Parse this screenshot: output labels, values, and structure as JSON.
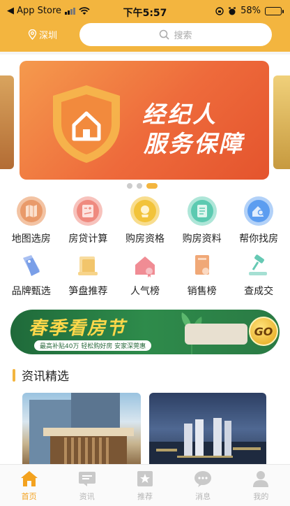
{
  "status_bar": {
    "back_app": "◀ App Store",
    "time": "下午5:57",
    "battery": "58%",
    "battery_level": 0.58
  },
  "header": {
    "city": "深圳",
    "search_placeholder": "搜索"
  },
  "banner": {
    "line1": "经纪人",
    "line2": "服务保障",
    "slide_count": 3,
    "active_slide": 3
  },
  "quick_entries": [
    {
      "label": "地图选房",
      "icon": "map-icon",
      "color": "#e99a6a"
    },
    {
      "label": "房贷计算",
      "icon": "calculator-icon",
      "color": "#ef8a7f"
    },
    {
      "label": "购房资格",
      "icon": "qualification-icon",
      "color": "#f2c33a"
    },
    {
      "label": "购房资料",
      "icon": "document-icon",
      "color": "#5ccab1"
    },
    {
      "label": "帮你找房",
      "icon": "find-house-icon",
      "color": "#5c9df0"
    }
  ],
  "quick_entries_2": [
    {
      "label": "品牌甄选",
      "icon": "tag-icon",
      "color": "#7a9fe8"
    },
    {
      "label": "笋盘推荐",
      "icon": "recommend-icon",
      "color": "#f2c56b"
    },
    {
      "label": "人气榜",
      "icon": "popular-icon",
      "color": "#f08c94"
    },
    {
      "label": "销售榜",
      "icon": "sales-icon",
      "color": "#f0a877"
    },
    {
      "label": "查成交",
      "icon": "gavel-icon",
      "color": "#66c9b4"
    }
  ],
  "promo": {
    "title": "春季看房节",
    "subtitle": "最高补贴40万 轻松购好房 安家深莞惠",
    "cta": "GO"
  },
  "news": {
    "section_title": "资讯精选"
  },
  "tabbar": [
    {
      "label": "首页",
      "icon": "home-icon",
      "active": true
    },
    {
      "label": "资讯",
      "icon": "news-icon",
      "active": false
    },
    {
      "label": "推荐",
      "icon": "recommend-star-icon",
      "active": false
    },
    {
      "label": "消息",
      "icon": "message-icon",
      "active": false
    },
    {
      "label": "我的",
      "icon": "profile-icon",
      "active": false
    }
  ],
  "colors": {
    "brand": "#f3b53f",
    "banner": "#ee6a3b",
    "promo_green": "#2e8b4b"
  }
}
